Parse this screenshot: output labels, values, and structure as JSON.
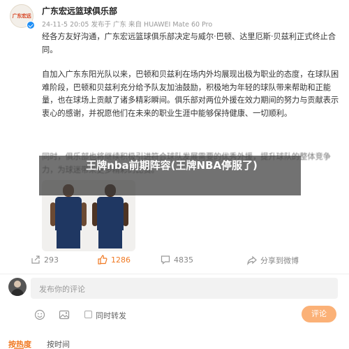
{
  "post": {
    "logo_text": "广东宏远",
    "account_name": "广东宏远篮球俱乐部",
    "meta": "24-11-5 20:05  发布于 广东  来自 HUAWEI Mate 60 Pro",
    "paragraph1": "经各方友好沟通，广东宏远篮球俱乐部决定与威尔·巴顿、达里厄斯·贝兹利正式终止合同。",
    "paragraph2": "自加入广东东阳光队以来，巴顿和贝兹利在场内外均展现出极为职业的态度，在球队困难阶段，巴顿和贝兹利充分给予队友加油鼓励，积极地为年轻的球队带来帮助和正能量，也在球场上贡献了诸多精彩瞬间。俱乐部对两位外援在效力期间的努力与贡献表示衷心的感谢，并祝愿他们在未来的职业生涯中能够保持健康、一切顺利。",
    "paragraph3": "同时，俱乐部也将继续积极引进符合球队发展需要的优秀外援，提升球队的整体竞争力，为球迷带来更多精彩的比赛。",
    "overlay_title": "王牌nba前期阵容(王牌NBA停服了)"
  },
  "actions": {
    "share_count": "293",
    "like_count": "1286",
    "comment_count": "4835",
    "collect_label": "分享到微博"
  },
  "comment": {
    "placeholder": "发布你的评论",
    "repost_label": "同时转发",
    "submit_label": "评论"
  },
  "sort": {
    "hot_label": "按热度",
    "time_label": "按时间"
  },
  "colors": {
    "accent": "#f07821",
    "jersey": "#1f3762",
    "verified": "#1e8ef5"
  }
}
